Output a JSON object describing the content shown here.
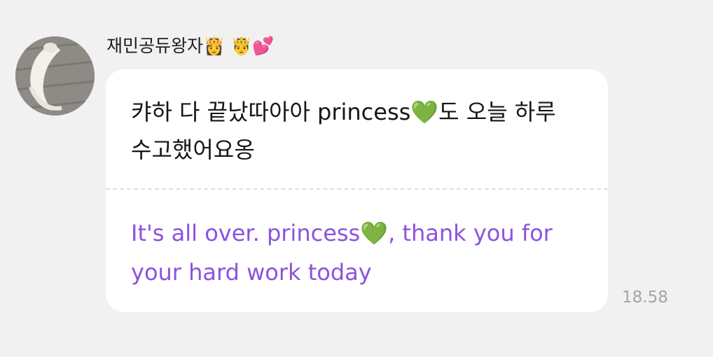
{
  "sender": {
    "name": "재민공듀왕자👸 🤴💕"
  },
  "message": {
    "original_text": "캬하 다 끝났따아아 princess💚도 오늘 하루 수고했어요옹",
    "translated_text": "It's all over. princess💚, thank you for your hard work today",
    "timestamp": "18.58"
  },
  "colors": {
    "background": "#f1f1f1",
    "bubble": "#ffffff",
    "translation_text": "#8d52de",
    "timestamp_text": "#a5a5a5"
  }
}
